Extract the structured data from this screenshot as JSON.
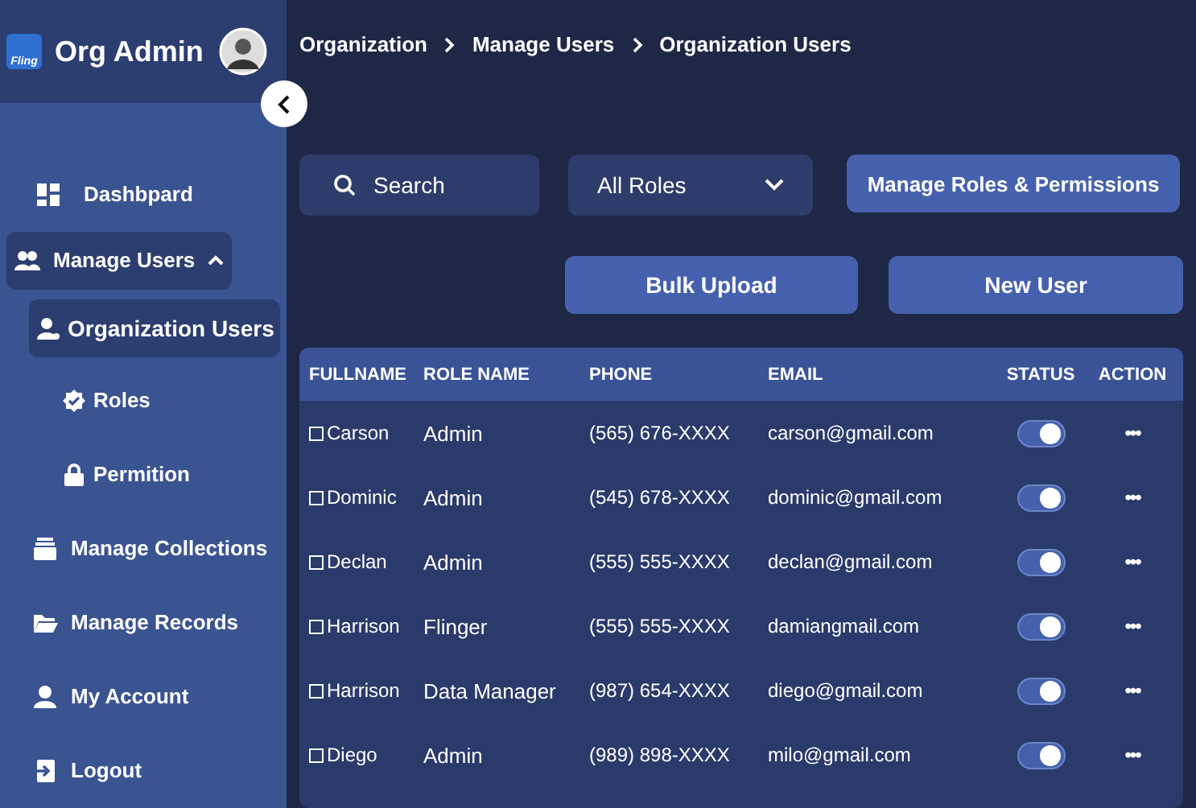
{
  "app": {
    "logo_text": "Fling",
    "title": "Org Admin"
  },
  "sidebar": {
    "items": [
      {
        "label": "Dashbpard",
        "selected": false
      },
      {
        "label": "Manage Users",
        "selected": true,
        "expanded": true,
        "children": [
          {
            "label": "Organization Users",
            "selected": true
          },
          {
            "label": "Roles",
            "selected": false
          },
          {
            "label": "Permition",
            "selected": false
          }
        ]
      },
      {
        "label": "Manage Collections",
        "selected": false
      },
      {
        "label": "Manage Records",
        "selected": false
      },
      {
        "label": "My Account",
        "selected": false
      },
      {
        "label": "Logout",
        "selected": false
      }
    ]
  },
  "breadcrumb": [
    "Organization",
    "Manage Users",
    "Organization Users"
  ],
  "toolbar": {
    "search": {
      "placeholder": "Search"
    },
    "role_filter": {
      "value": "All Roles"
    },
    "buttons": [
      "Manage Roles & Permissions",
      "Bulk Upload",
      "New User"
    ]
  },
  "table": {
    "columns": [
      "FULLNAME",
      "ROLE NAME",
      "PHONE",
      "EMAIL",
      "STATUS",
      "ACTION"
    ],
    "rows": [
      {
        "checked": false,
        "fullname": "Carson",
        "role": "Admin",
        "phone": "(565) 676-XXXX",
        "email": "carson@gmail.com",
        "status_on": true,
        "action": "•••"
      },
      {
        "checked": false,
        "fullname": "Dominic",
        "role": "Admin",
        "phone": "(545) 678-XXXX",
        "email": "dominic@gmail.com",
        "status_on": true,
        "action": "•••"
      },
      {
        "checked": false,
        "fullname": "Declan",
        "role": "Admin",
        "phone": "(555) 555-XXXX",
        "email": "declan@gmail.com",
        "status_on": true,
        "action": "•••"
      },
      {
        "checked": false,
        "fullname": "Harrison",
        "role": "Flinger",
        "phone": "(555) 555-XXXX",
        "email": "damiangmail.com",
        "status_on": true,
        "action": "•••"
      },
      {
        "checked": false,
        "fullname": "Harrison",
        "role": "Data Manager",
        "phone": "(987) 654-XXXX",
        "email": "diego@gmail.com",
        "status_on": true,
        "action": "•••"
      },
      {
        "checked": false,
        "fullname": "Diego",
        "role": "Admin",
        "phone": "(989) 898-XXXX",
        "email": "milo@gmail.com",
        "status_on": true,
        "action": "•••"
      }
    ]
  }
}
